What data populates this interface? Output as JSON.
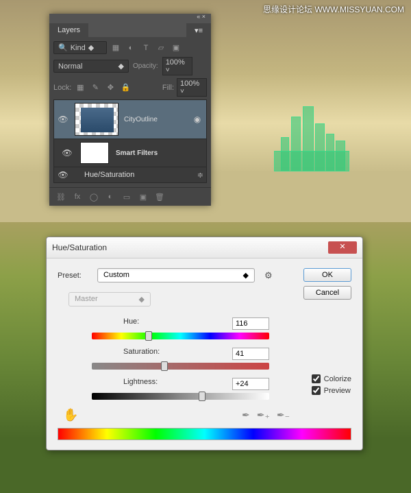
{
  "watermark": "思缘设计论坛 WWW.MISSYUAN.COM",
  "layersPanel": {
    "title": "Layers",
    "kindLabel": "Kind",
    "blendMode": "Normal",
    "opacityLabel": "Opacity:",
    "opacityValue": "100%",
    "lockLabel": "Lock:",
    "fillLabel": "Fill:",
    "fillValue": "100%",
    "layer1": "CityOutline",
    "smartFilters": "Smart Filters",
    "hueSaturation": "Hue/Saturation"
  },
  "dialog": {
    "title": "Hue/Saturation",
    "presetLabel": "Preset:",
    "presetValue": "Custom",
    "okLabel": "OK",
    "cancelLabel": "Cancel",
    "masterLabel": "Master",
    "hueLabel": "Hue:",
    "hueValue": "116",
    "satLabel": "Saturation:",
    "satValue": "41",
    "lightLabel": "Lightness:",
    "lightValue": "+24",
    "colorizeLabel": "Colorize",
    "previewLabel": "Preview"
  }
}
